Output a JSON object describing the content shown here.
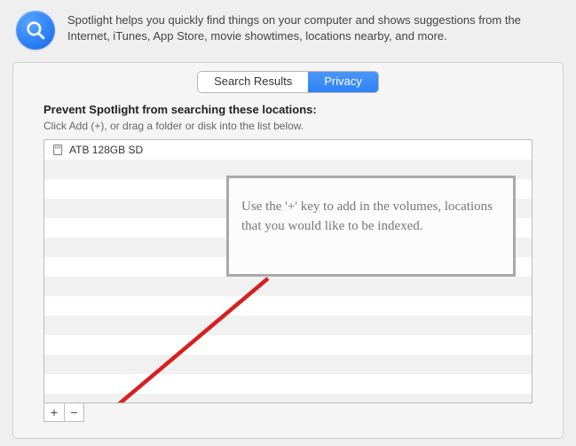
{
  "header": {
    "description": "Spotlight helps you quickly find things on your computer and shows suggestions from the Internet, iTunes, App Store, movie showtimes, locations nearby, and more."
  },
  "tabs": {
    "search_results": "Search Results",
    "privacy": "Privacy"
  },
  "privacy": {
    "heading": "Prevent Spotlight from searching these locations:",
    "subtext": "Click Add (+), or drag a folder or disk into the list below.",
    "items": [
      {
        "name": "ATB 128GB SD"
      }
    ]
  },
  "buttons": {
    "add": "+",
    "remove": "−"
  },
  "annotation": {
    "text": "Use the '+' key to add in the volumes, locations that you would like to be indexed."
  }
}
